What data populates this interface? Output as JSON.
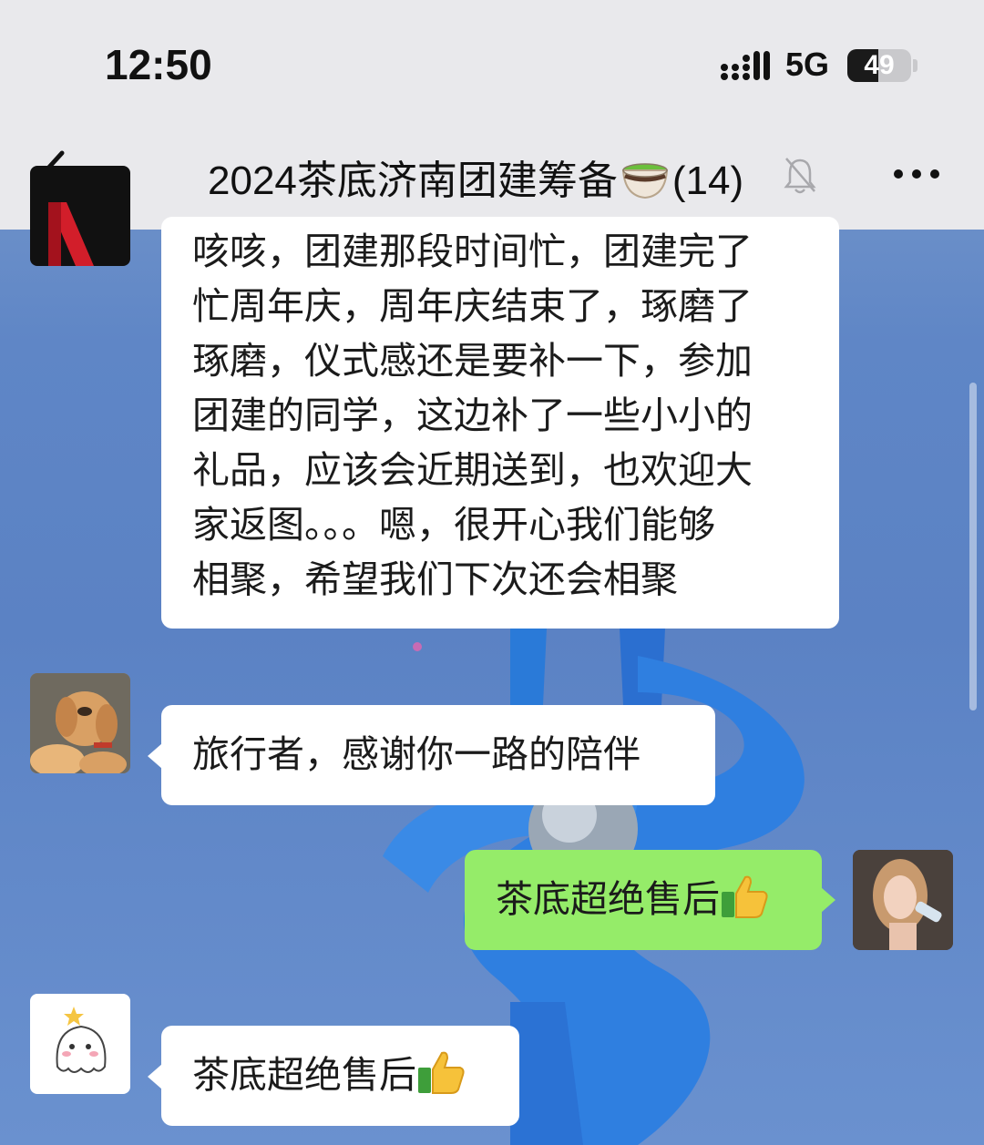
{
  "status_bar": {
    "time": "12:50",
    "network": "5G",
    "battery_level": "49"
  },
  "nav": {
    "title": "2024茶底济南团建筹备",
    "member_count": "(14)",
    "icons": [
      "back-chevron-icon",
      "tea-cup-emoji-icon",
      "mute-bell-icon",
      "more-dots-icon"
    ]
  },
  "messages": [
    {
      "sender": "other",
      "avatar": "avatar-red-logo",
      "text": "咳咳，团建那段时间忙，团建完了忙周年庆，周年庆结束了，琢磨了琢磨，仪式感还是要补一下，参加团建的同学，这边补了一些小小的礼品，应该会近期送到，也欢迎大家返图。。。嗯，很开心我们能够相聚，希望我们下次还会相聚",
      "lines": [
        "咳咳，团建那段时间忙，团建完了",
        "忙周年庆，周年庆结束了，琢磨了",
        "琢磨，仪式感还是要补一下，参加",
        "团建的同学，这边补了一些小小的",
        "礼品，应该会近期送到，也欢迎大",
        "家返图。。。嗯，很开心我们能够",
        "相聚，希望我们下次还会相聚"
      ]
    },
    {
      "sender": "other",
      "avatar": "avatar-dog",
      "text": "旅行者，感谢你一路的陪伴"
    },
    {
      "sender": "self",
      "avatar": "avatar-woman",
      "text": "茶底超绝售后",
      "emoji": "thumbs-up-emoji-icon"
    },
    {
      "sender": "other",
      "avatar": "avatar-ghost",
      "text": "茶底超绝售后",
      "emoji": "thumbs-up-emoji-icon"
    }
  ],
  "colors": {
    "bubble_self": "#95ec69",
    "bubble_other": "#ffffff",
    "nav_background": "#e9e9ec"
  }
}
